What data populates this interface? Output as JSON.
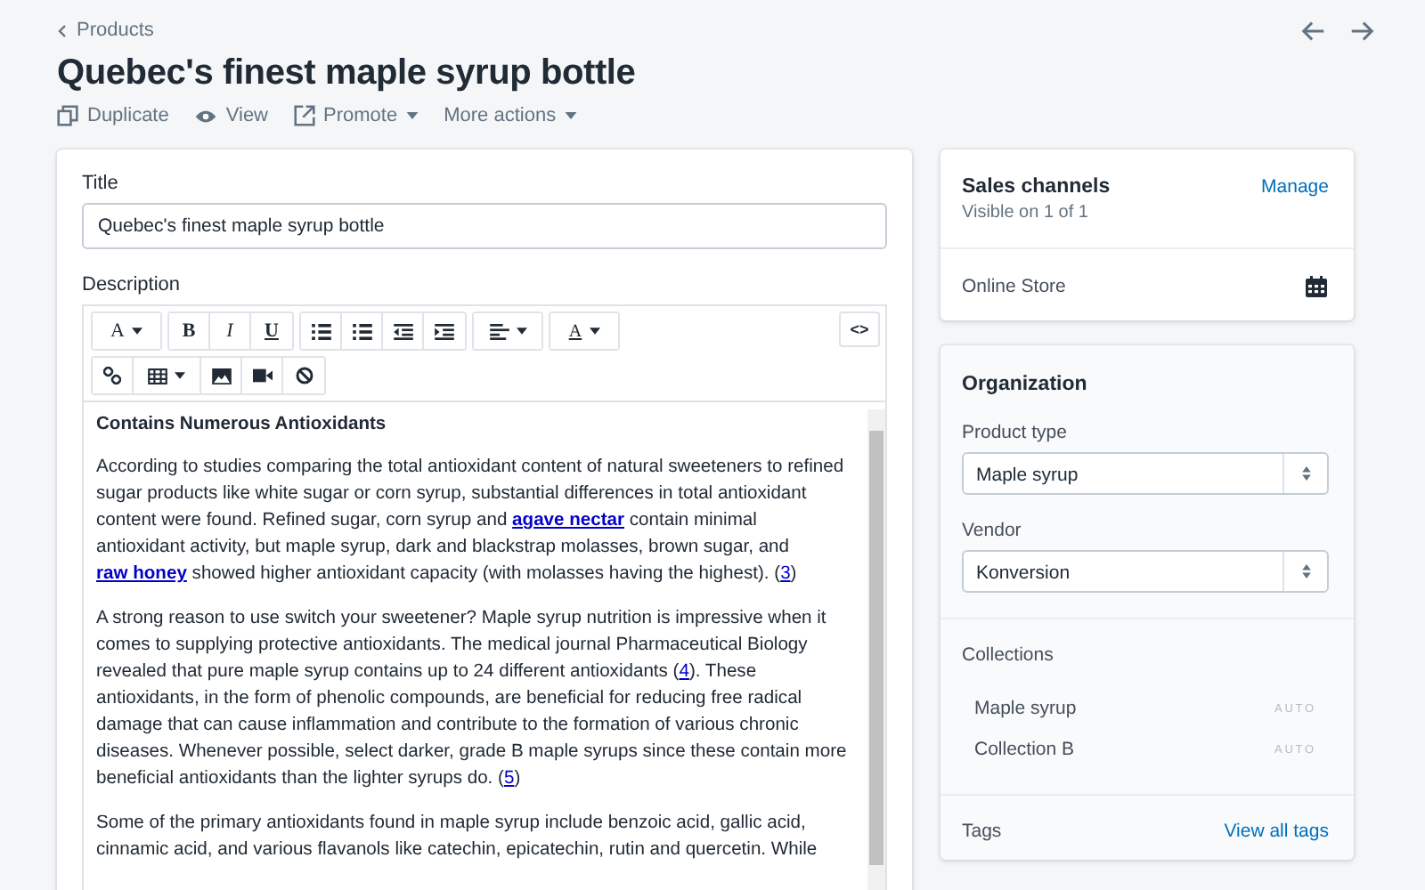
{
  "breadcrumb": {
    "label": "Products"
  },
  "page_title": "Quebec's finest maple syrup bottle",
  "actions": [
    {
      "kind": "duplicate",
      "label": "Duplicate",
      "dropdown": false
    },
    {
      "kind": "view",
      "label": "View",
      "dropdown": false
    },
    {
      "kind": "promote",
      "label": "Promote",
      "dropdown": true
    },
    {
      "kind": "more",
      "label": "More actions",
      "dropdown": true
    }
  ],
  "title_field": {
    "label": "Title",
    "value": "Quebec's finest maple syrup bottle"
  },
  "description": {
    "label": "Description",
    "toolbar_rows": [
      [
        [
          {
            "kind": "font",
            "label": "A",
            "dropdown": true
          }
        ],
        [
          {
            "kind": "bold",
            "label": "B",
            "dropdown": false
          },
          {
            "kind": "italic",
            "label": "I",
            "dropdown": false
          },
          {
            "kind": "underline",
            "label": "U",
            "dropdown": false
          }
        ],
        [
          {
            "kind": "bullets",
            "dropdown": false
          },
          {
            "kind": "numbers",
            "dropdown": false
          },
          {
            "kind": "outdent",
            "dropdown": false
          },
          {
            "kind": "indent",
            "dropdown": false
          }
        ],
        [
          {
            "kind": "align",
            "dropdown": true
          }
        ],
        [
          {
            "kind": "color",
            "label": "A",
            "dropdown": true
          }
        ]
      ],
      [
        [
          {
            "kind": "link",
            "dropdown": false
          },
          {
            "kind": "table",
            "dropdown": true
          },
          {
            "kind": "image",
            "dropdown": false
          },
          {
            "kind": "video",
            "dropdown": false
          },
          {
            "kind": "clear",
            "dropdown": false
          }
        ]
      ]
    ],
    "html_button": "<>",
    "heading": "Contains Numerous Antioxidants",
    "paragraphs": [
      [
        {
          "text": "According to studies comparing the total antioxidant content of natural sweeteners to refined sugar products like white sugar or corn syrup, substantial differences in total antioxidant content were found. Refined sugar, corn syrup and "
        },
        {
          "link": "agave nectar",
          "bold": true
        },
        {
          "text": " contain minimal antioxidant activity, but maple syrup, dark and blackstrap molasses, brown sugar, and "
        },
        {
          "link": "raw honey",
          "bold": true
        },
        {
          "text": " showed higher antioxidant capacity (with molasses having the highest). ("
        },
        {
          "link": "3",
          "bold": false
        },
        {
          "text": ")"
        }
      ],
      [
        {
          "text": "A strong reason to use switch your sweetener? Maple syrup nutrition is impressive when it comes to supplying protective antioxidants. The medical journal Pharmaceutical Biology revealed that pure maple syrup contains up to 24 different antioxidants ("
        },
        {
          "link": "4",
          "bold": false
        },
        {
          "text": "). These antioxidants, in the form of phenolic compounds, are beneficial for reducing free radical damage that can cause inflammation and contribute to the formation of various chronic diseases. Whenever possible, select darker, grade B maple syrups since these contain more beneficial antioxidants than the lighter syrups do. ("
        },
        {
          "link": "5",
          "bold": false
        },
        {
          "text": ")"
        }
      ],
      [
        {
          "text": "Some of the primary antioxidants found in maple syrup include benzoic acid, gallic acid, cinnamic acid, and various flavanols like catechin, epicatechin, rutin and quercetin. While"
        }
      ]
    ]
  },
  "sales_channels": {
    "title": "Sales channels",
    "manage": "Manage",
    "subtitle": "Visible on 1 of 1",
    "channels": [
      {
        "name": "Online Store"
      }
    ]
  },
  "organization": {
    "title": "Organization",
    "fields": [
      {
        "label": "Product type",
        "value": "Maple syrup"
      },
      {
        "label": "Vendor",
        "value": "Konversion"
      }
    ],
    "collections_label": "Collections",
    "collections": [
      {
        "name": "Maple syrup",
        "badge": "AUTO"
      },
      {
        "name": "Collection B",
        "badge": "AUTO"
      }
    ],
    "tags_label": "Tags",
    "tags_link": "View all tags"
  }
}
